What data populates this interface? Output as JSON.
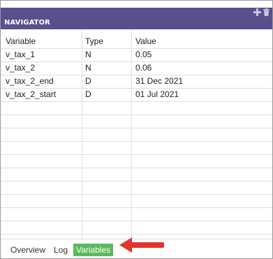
{
  "navigator": {
    "title": "NAVIGATOR",
    "tools": {
      "add_icon": "plus-icon",
      "delete_icon": "trash-icon"
    }
  },
  "table": {
    "columns": [
      "Variable",
      "Type",
      "Value"
    ],
    "rows": [
      {
        "variable": "v_tax_1",
        "type": "N",
        "value": "0.05"
      },
      {
        "variable": "v_tax_2",
        "type": "N",
        "value": "0.06"
      },
      {
        "variable": "v_tax_2_end",
        "type": "D",
        "value": "31 Dec 2021"
      },
      {
        "variable": "v_tax_2_start",
        "type": "D",
        "value": "01 Jul 2021"
      }
    ]
  },
  "tabs": [
    {
      "label": "Overview",
      "active": false
    },
    {
      "label": "Log",
      "active": false
    },
    {
      "label": "Variables",
      "active": true
    }
  ],
  "colors": {
    "titlebar": "#5a4f8c",
    "active_tab": "#5cb85c",
    "arrow": "#e2342f"
  }
}
